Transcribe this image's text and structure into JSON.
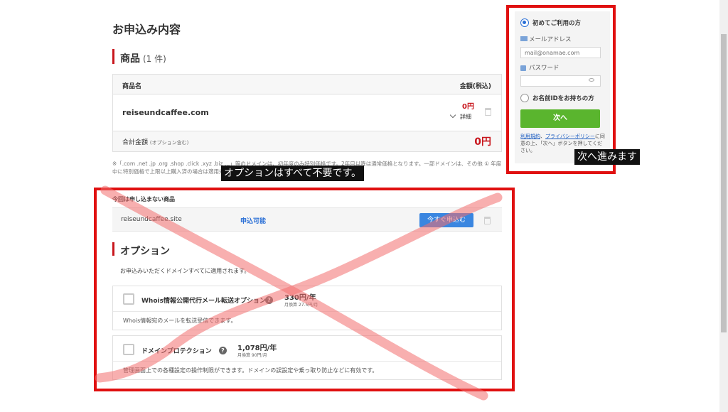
{
  "page": {
    "title": "お申込み内容",
    "products_section": {
      "title": "商品",
      "count": "(1 件)"
    },
    "table": {
      "col_name": "商品名",
      "col_price": "金額(税込)",
      "row": {
        "domain": "reiseundcaffee.com",
        "price": "0円",
        "details": "詳細"
      },
      "total_label": "合計金額",
      "total_note": "(オプション含む)",
      "total_value": "0円"
    },
    "note": "※「.com .net .jp .org .shop .click .xyz .biz …」等のドメインは、初年度のみ特別価格です。2年目以降は通常価格となります。一部ドメインは、その他 ① 年度中に特別価格で上限以上購入済の場合は適用外",
    "annotation_options": "オプションはすべて不要です。",
    "annotation_next": "次へ進みます",
    "not_applied": {
      "heading": "今回は申し込まない商品",
      "domain": "reiseundcaffee.site",
      "status": "申込可能",
      "button": "今すぐ申込む"
    },
    "options_section": {
      "title": "オプション",
      "description": "お申込みいただくドメインすべてに適用されます。",
      "items": [
        {
          "name": "Whois情報公開代行メール転送オプション",
          "price": "330円/年",
          "monthly": "月換算 27.5円/月",
          "desc": "Whois情報宛のメールを転送受信できます。"
        },
        {
          "name": "ドメインプロテクション",
          "price": "1,078円/年",
          "monthly": "月換算 90円/月",
          "desc": "管理画面上での各種設定の操作制限ができます。ドメインの誤設定や乗っ取り防止などに有効です。"
        }
      ]
    }
  },
  "login": {
    "first_time": "初めてご利用の方",
    "email_label": "メールアドレス",
    "email_placeholder": "mail@onamae.com",
    "password_label": "パスワード",
    "has_id": "お名前IDをお持ちの方",
    "next_button": "次へ",
    "terms_link": "利用規約",
    "comma": "、",
    "privacy_link": "プライバシーポリシー",
    "agree_text": "に同意の上、「次へ」ボタンを押してください。"
  },
  "colors": {
    "accent_red": "#c8161d",
    "annotation_red": "#e01010",
    "primary_blue": "#3a86e0",
    "next_green": "#5ab52e"
  }
}
